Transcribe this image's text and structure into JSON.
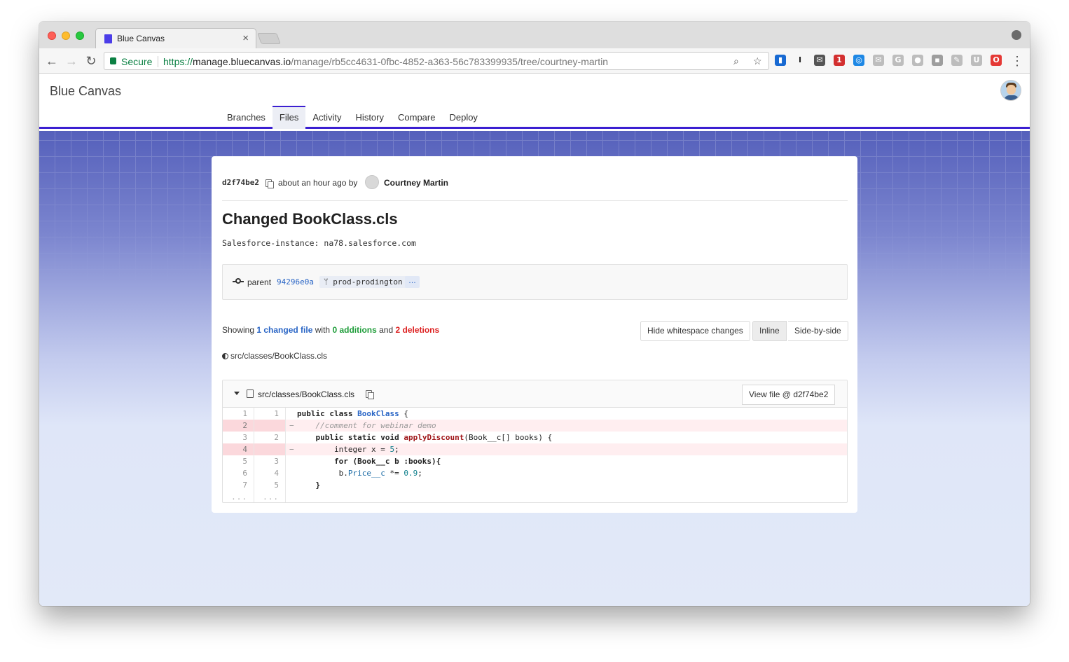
{
  "browser": {
    "tab_title": "Blue Canvas",
    "tab_close": "×",
    "secure_label": "Secure",
    "url_scheme": "https://",
    "url_host": "manage.bluecanvas.io",
    "url_path": "/manage/rb5cc4631-0fbc-4852-a363-56c783399935/tree/courtney-martin",
    "nav_back": "←",
    "nav_forward": "→",
    "nav_reload": "↻",
    "zoom_icon": "⌕",
    "star_icon": "☆",
    "menu_icon": "⋮",
    "extensions": [
      {
        "name": "trello-extension-icon",
        "color": "#1769d2",
        "glyph": "▮"
      },
      {
        "name": "instapaper-extension-icon",
        "color": "#ffffff",
        "glyph": "I"
      },
      {
        "name": "inbox-extension-icon",
        "color": "#555555",
        "glyph": "✉"
      },
      {
        "name": "calendar-extension-icon",
        "color": "#d32f2f",
        "glyph": "1"
      },
      {
        "name": "compass-extension-icon",
        "color": "#1e88e5",
        "glyph": "◎"
      },
      {
        "name": "mail-extension-icon",
        "color": "#bdbdbd",
        "glyph": "✉"
      },
      {
        "name": "grammarly-extension-icon",
        "color": "#bdbdbd",
        "glyph": "G"
      },
      {
        "name": "ghost-extension-icon",
        "color": "#bdbdbd",
        "glyph": "●"
      },
      {
        "name": "notes-extension-icon",
        "color": "#9e9e9e",
        "glyph": "▪"
      },
      {
        "name": "tag-extension-icon",
        "color": "#bdbdbd",
        "glyph": "✎"
      },
      {
        "name": "shield-extension-icon",
        "color": "#bdbdbd",
        "glyph": "U"
      },
      {
        "name": "opera-extension-icon",
        "color": "#e53935",
        "glyph": "O"
      }
    ]
  },
  "app": {
    "brand": "Blue Canvas",
    "nav": [
      "Branches",
      "Files",
      "Activity",
      "History",
      "Compare",
      "Deploy"
    ],
    "active_nav": "Files",
    "accent_color": "#3b1fd1"
  },
  "commit": {
    "sha": "d2f74be2",
    "time": "about an hour ago by",
    "author": "Courtney Martin",
    "title": "Changed BookClass.cls",
    "body": "Salesforce-instance: na78.salesforce.com",
    "parent_label": "parent",
    "parent_sha": "94296e0a",
    "branch": "prod-prodington",
    "branch_icon": "ᛘ",
    "more": "…"
  },
  "summary": {
    "prefix": "Showing",
    "changed": "1 changed file",
    "with": "with",
    "additions": "0 additions",
    "and": "and",
    "deletions": "2 deletions"
  },
  "buttons": {
    "hide_whitespace": "Hide whitespace changes",
    "inline": "Inline",
    "side_by_side": "Side-by-side",
    "view_file": "View file @ d2f74be2"
  },
  "file_list": [
    "src/classes/BookClass.cls"
  ],
  "diff": {
    "filename": "src/classes/BookClass.cls",
    "more_marker": "...",
    "lines": [
      {
        "old": "1",
        "new": "1",
        "type": "ctx",
        "sign": ""
      },
      {
        "old": "2",
        "new": "",
        "type": "del",
        "sign": "−"
      },
      {
        "old": "3",
        "new": "2",
        "type": "ctx",
        "sign": ""
      },
      {
        "old": "4",
        "new": "",
        "type": "del",
        "sign": "−"
      },
      {
        "old": "5",
        "new": "3",
        "type": "ctx",
        "sign": ""
      },
      {
        "old": "6",
        "new": "4",
        "type": "ctx",
        "sign": ""
      },
      {
        "old": "7",
        "new": "5",
        "type": "ctx",
        "sign": ""
      }
    ],
    "code_tokens": {
      "l1": [
        "public class ",
        "BookClass",
        " {"
      ],
      "l2": [
        "    //comment for webinar demo"
      ],
      "l3": [
        "    public static void ",
        "applyDiscount",
        "(Book__c[] books) {"
      ],
      "l4": [
        "        integer x = ",
        "5",
        ";"
      ],
      "l5": [
        "        for (Book__c b :books){"
      ],
      "l6": [
        "         b.",
        "Price__c",
        " *= ",
        "0.9",
        ";"
      ],
      "l7": [
        "    }"
      ]
    }
  }
}
